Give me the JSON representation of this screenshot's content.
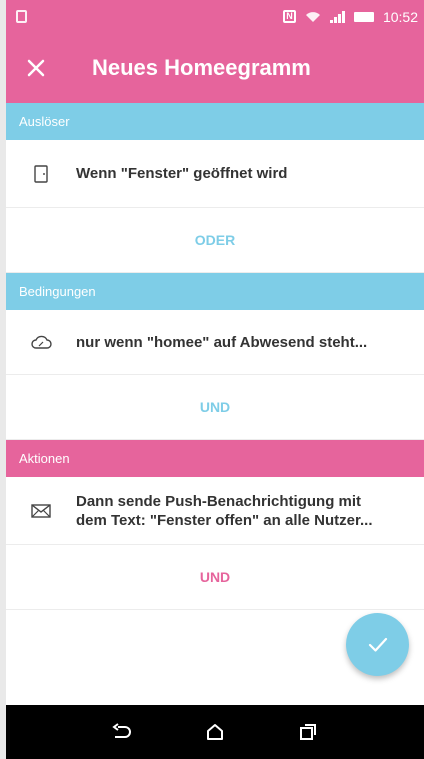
{
  "status_bar": {
    "time": "10:52",
    "nfc_label": "N",
    "icons": [
      "notification-icon",
      "nfc-icon",
      "wifi-icon",
      "signal-icon",
      "battery-icon"
    ]
  },
  "app_bar": {
    "title": "Neues Homeegramm",
    "close_icon": "close-icon"
  },
  "sections": {
    "trigger": {
      "header": "Auslöser",
      "item_text": "Wenn \"Fenster\" geöffnet wird",
      "item_icon": "window-sensor-icon",
      "link": "ODER"
    },
    "conditions": {
      "header": "Bedingungen",
      "item_text": "nur wenn \"homee\" auf Abwesend steht...",
      "item_icon": "cloud-icon",
      "link": "UND"
    },
    "actions": {
      "header": "Aktionen",
      "item_text_line1": "Dann sende Push-Benachrichtigung mit",
      "item_text_line2": "dem Text: \"Fenster offen\" an alle Nutzer...",
      "item_icon": "mail-icon",
      "link": "UND"
    }
  },
  "fab": {
    "icon": "check-icon"
  },
  "nav_bar": {
    "icons": [
      "back-icon",
      "home-icon",
      "recents-icon"
    ]
  },
  "colors": {
    "pink": "#e6649c",
    "blue": "#7ecde7",
    "text": "#333333",
    "nav": "#000000"
  }
}
